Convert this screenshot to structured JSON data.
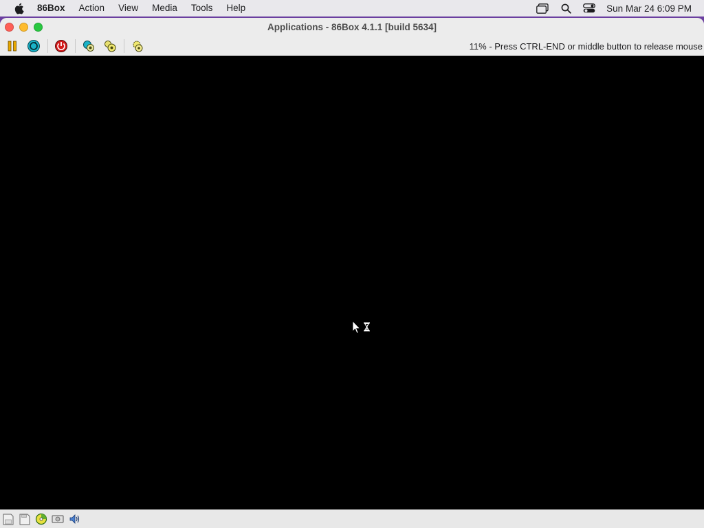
{
  "menubar": {
    "apple_icon": "apple-logo-icon",
    "app_name": "86Box",
    "items": [
      "Action",
      "View",
      "Media",
      "Tools",
      "Help"
    ],
    "status_icons": [
      "window-switcher-icon",
      "spotlight-search-icon",
      "control-center-icon"
    ],
    "clock": "Sun Mar 24  6:09 PM"
  },
  "window": {
    "title": "Applications - 86Box 4.1.1 [build 5634]",
    "colors": {
      "close": "#ff5f57",
      "minimize": "#febc2e",
      "maximize": "#28c840"
    }
  },
  "toolbar": {
    "buttons": [
      {
        "name": "pause-button",
        "icon": "pause-icon"
      },
      {
        "name": "ctrl-alt-del-button",
        "icon": "reset-cycle-icon"
      },
      {
        "name": "power-off-button",
        "icon": "power-icon"
      },
      {
        "name": "hard-reset-button",
        "icon": "gear-reset-icon"
      },
      {
        "name": "ctrl-alt-esc-button",
        "icon": "gear-star-icon"
      },
      {
        "name": "settings-button",
        "icon": "settings-gear-icon"
      }
    ],
    "status_message": "11% - Press CTRL-END or middle button to release mouse"
  },
  "statusbar": {
    "icons": [
      "floppy-drive-1-icon",
      "floppy-drive-2-icon",
      "cdrom-drive-icon",
      "hard-disk-icon",
      "sound-icon"
    ]
  },
  "screen": {
    "background": "#000000",
    "cursor": "wait-arrow-hourglass-icon"
  }
}
